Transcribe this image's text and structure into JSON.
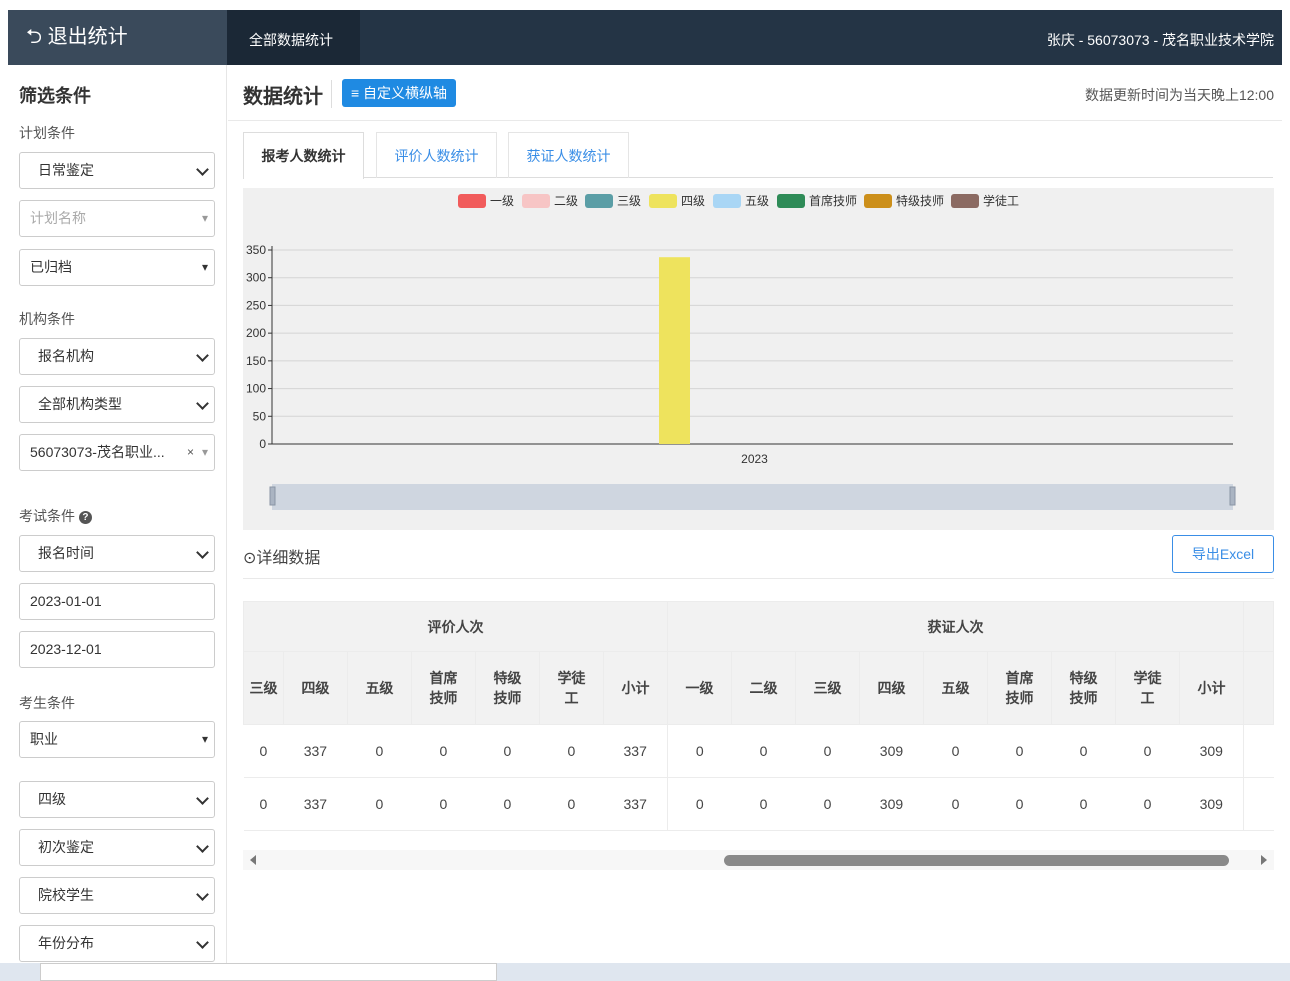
{
  "topbar": {
    "exit_label": "⮌ 退出统计",
    "tab_label": "全部数据统计",
    "user": "张庆 - 56073073 - 茂名职业技术学院"
  },
  "sidebar": {
    "title": "筛选条件",
    "plan_label": "计划条件",
    "plan_type": "日常鉴定",
    "plan_name_placeholder": "计划名称",
    "plan_status": "已归档",
    "org_label": "机构条件",
    "org_select": "报名机构",
    "org_type": "全部机构类型",
    "org_value": "56073073-茂名职业...",
    "exam_label": "考试条件",
    "exam_time": "报名时间",
    "date_start": "2023-01-01",
    "date_end": "2023-12-01",
    "candidate_label": "考生条件",
    "occupation": "职业",
    "level": "四级",
    "appraisal_type": "初次鉴定",
    "student_type": "院校学生",
    "year_dist": "年份分布"
  },
  "main": {
    "title": "数据统计",
    "axis_button": "≡ 自定义横纵轴",
    "update_note": "数据更新时间为当天晚上12:00",
    "tabs": [
      "报考人数统计",
      "评价人数统计",
      "获证人数统计"
    ],
    "detail_label": "⊙详细数据",
    "export_label": "导出Excel"
  },
  "chart_data": {
    "type": "bar",
    "categories": [
      "2023"
    ],
    "series": [
      {
        "name": "一级",
        "color": "#f15b5b",
        "values": [
          0
        ]
      },
      {
        "name": "二级",
        "color": "#f7c5c5",
        "values": [
          0
        ]
      },
      {
        "name": "三级",
        "color": "#5b9ea6",
        "values": [
          0
        ]
      },
      {
        "name": "四级",
        "color": "#eee35d",
        "values": [
          337
        ]
      },
      {
        "name": "五级",
        "color": "#a9d6f5",
        "values": [
          0
        ]
      },
      {
        "name": "首席技师",
        "color": "#2e8b57",
        "values": [
          0
        ]
      },
      {
        "name": "特级技师",
        "color": "#cc8f1a",
        "values": [
          0
        ]
      },
      {
        "name": "学徒工",
        "color": "#8b6a62",
        "values": [
          0
        ]
      }
    ],
    "yticks": [
      "0",
      "50",
      "100",
      "150",
      "200",
      "250",
      "300",
      "350"
    ],
    "ylim": [
      0,
      350
    ],
    "grid": true,
    "legend": "top"
  },
  "table": {
    "groups": [
      "评价人次",
      "获证人次"
    ],
    "eval_columns": [
      "三级",
      "四级",
      "五级",
      "首席\n技师",
      "特级\n技师",
      "学徒\n工",
      "小计"
    ],
    "cert_columns": [
      "一级",
      "二级",
      "三级",
      "四级",
      "五级",
      "首席\n技师",
      "特级\n技师",
      "学徒\n工",
      "小计"
    ],
    "rows": [
      [
        "0",
        "337",
        "0",
        "0",
        "0",
        "0",
        "337",
        "0",
        "0",
        "0",
        "309",
        "0",
        "0",
        "0",
        "0",
        "309"
      ],
      [
        "0",
        "337",
        "0",
        "0",
        "0",
        "0",
        "337",
        "0",
        "0",
        "0",
        "309",
        "0",
        "0",
        "0",
        "0",
        "309"
      ]
    ]
  }
}
